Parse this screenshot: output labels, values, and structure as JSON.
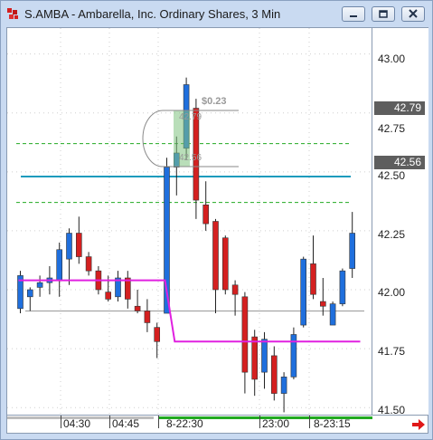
{
  "window": {
    "title": "S.AMBA - Ambarella, Inc. Ordinary Shares, 3 Min",
    "icons": [
      "app-icon",
      "minimize-icon",
      "restore-icon",
      "close-icon"
    ]
  },
  "price_axis": {
    "ticks": [
      "43.00",
      "42.75",
      "42.50",
      "42.25",
      "42.00",
      "41.75",
      "41.50"
    ],
    "markers": [
      "42.79",
      "42.56"
    ]
  },
  "time_axis": {
    "labels": [
      "04:30",
      "04:45",
      "8-22:30",
      "23:00",
      "8-23:15"
    ]
  },
  "annotations": {
    "delta": "$0.23",
    "high": "42.79",
    "low": "42.56"
  },
  "colors": {
    "up_candle": "#1f6fdd",
    "down_candle": "#d42020",
    "vwap_line": "#e020e0",
    "cyan_level": "#1a9bbd",
    "green_level": "#22aa22"
  },
  "chart_data": {
    "type": "candlestick",
    "ylim": [
      41.47,
      43.11
    ],
    "candles": [
      {
        "o": 41.92,
        "h": 42.08,
        "l": 41.9,
        "c": 42.06
      },
      {
        "o": 41.97,
        "h": 42.01,
        "l": 41.91,
        "c": 42.0
      },
      {
        "o": 42.01,
        "h": 42.06,
        "l": 41.97,
        "c": 42.03
      },
      {
        "o": 42.03,
        "h": 42.1,
        "l": 41.98,
        "c": 42.05
      },
      {
        "o": 42.04,
        "h": 42.2,
        "l": 41.97,
        "c": 42.17
      },
      {
        "o": 42.13,
        "h": 42.26,
        "l": 42.02,
        "c": 42.24
      },
      {
        "o": 42.24,
        "h": 42.31,
        "l": 42.11,
        "c": 42.14
      },
      {
        "o": 42.14,
        "h": 42.16,
        "l": 42.06,
        "c": 42.08
      },
      {
        "o": 42.08,
        "h": 42.1,
        "l": 41.98,
        "c": 42.0
      },
      {
        "o": 41.99,
        "h": 42.06,
        "l": 41.95,
        "c": 41.96
      },
      {
        "o": 41.97,
        "h": 42.08,
        "l": 41.95,
        "c": 42.05
      },
      {
        "o": 42.05,
        "h": 42.08,
        "l": 41.92,
        "c": 41.96
      },
      {
        "o": 41.93,
        "h": 42.0,
        "l": 41.9,
        "c": 41.91
      },
      {
        "o": 41.91,
        "h": 41.96,
        "l": 41.82,
        "c": 41.86
      },
      {
        "o": 41.84,
        "h": 41.86,
        "l": 41.71,
        "c": 41.78
      },
      {
        "o": 41.9,
        "h": 42.56,
        "l": 41.9,
        "c": 42.52
      },
      {
        "o": 42.52,
        "h": 42.65,
        "l": 42.4,
        "c": 42.58
      },
      {
        "o": 42.6,
        "h": 42.9,
        "l": 42.55,
        "c": 42.87
      },
      {
        "o": 42.77,
        "h": 42.81,
        "l": 42.3,
        "c": 42.38
      },
      {
        "o": 42.36,
        "h": 42.46,
        "l": 42.25,
        "c": 42.28
      },
      {
        "o": 42.29,
        "h": 42.3,
        "l": 41.9,
        "c": 42.0
      },
      {
        "o": 42.22,
        "h": 42.23,
        "l": 41.98,
        "c": 42.0
      },
      {
        "o": 42.02,
        "h": 42.04,
        "l": 41.89,
        "c": 41.98
      },
      {
        "o": 41.97,
        "h": 41.99,
        "l": 41.56,
        "c": 41.65
      },
      {
        "o": 41.8,
        "h": 41.83,
        "l": 41.55,
        "c": 41.62
      },
      {
        "o": 41.65,
        "h": 41.82,
        "l": 41.58,
        "c": 41.79
      },
      {
        "o": 41.72,
        "h": 41.76,
        "l": 41.53,
        "c": 41.56
      },
      {
        "o": 41.56,
        "h": 41.65,
        "l": 41.48,
        "c": 41.63
      },
      {
        "o": 41.63,
        "h": 41.84,
        "l": 41.62,
        "c": 41.81
      },
      {
        "o": 41.85,
        "h": 42.14,
        "l": 41.84,
        "c": 42.13
      },
      {
        "o": 42.11,
        "h": 42.23,
        "l": 41.96,
        "c": 41.98
      },
      {
        "o": 41.95,
        "h": 42.05,
        "l": 41.89,
        "c": 41.93
      },
      {
        "o": 41.85,
        "h": 41.95,
        "l": 41.85,
        "c": 41.94
      },
      {
        "o": 41.94,
        "h": 42.09,
        "l": 41.93,
        "c": 42.08
      },
      {
        "o": 42.09,
        "h": 42.33,
        "l": 42.05,
        "c": 42.24
      }
    ],
    "levels": [
      {
        "name": "cyan",
        "y": 42.48
      },
      {
        "name": "green-upper",
        "y": 42.62
      },
      {
        "name": "green-lower",
        "y": 42.37
      },
      {
        "name": "gray",
        "y": 41.91
      }
    ],
    "vwap": [
      [
        0,
        42.04
      ],
      [
        15,
        42.04
      ],
      [
        16,
        41.78
      ],
      [
        35,
        41.78
      ]
    ]
  }
}
